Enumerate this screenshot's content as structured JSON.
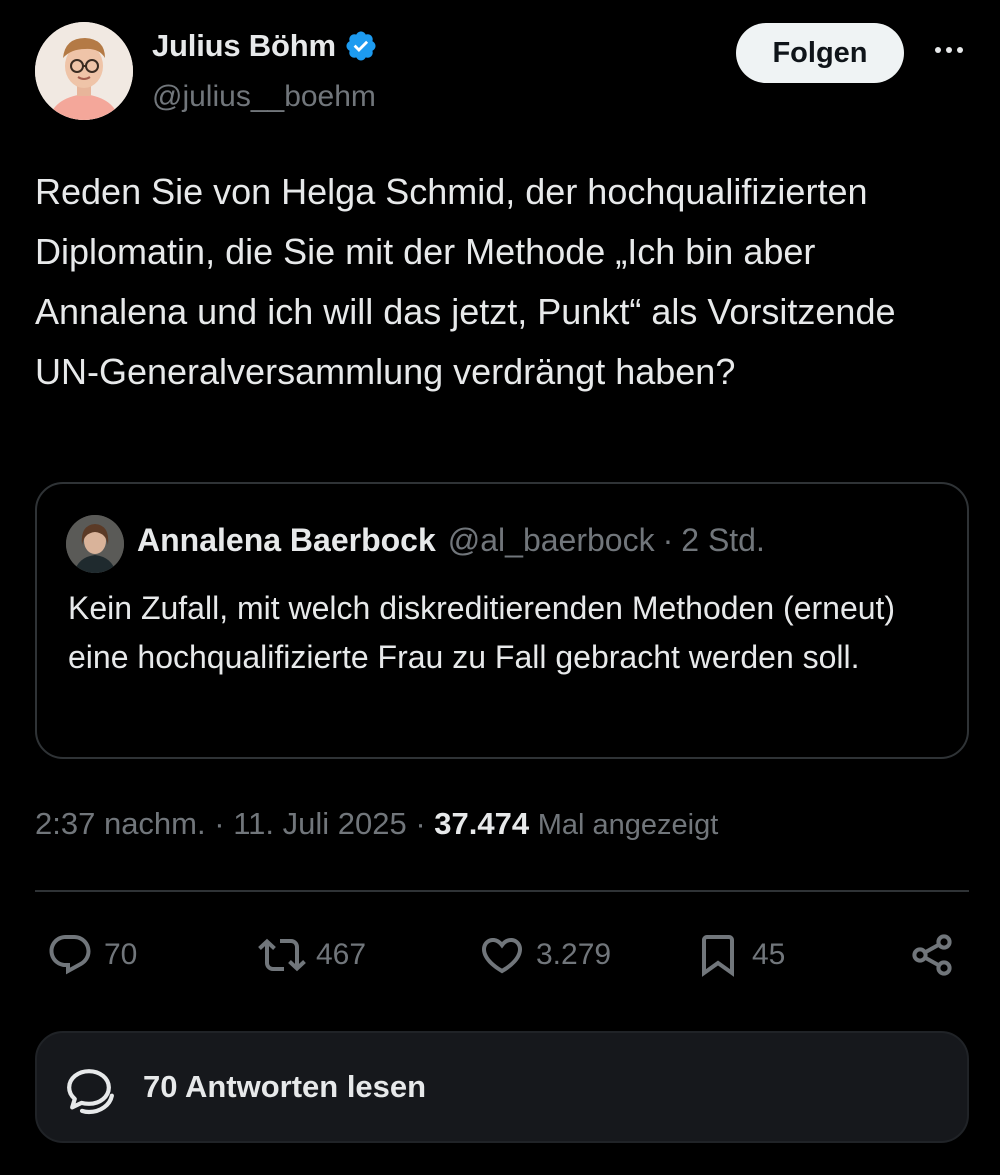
{
  "author": {
    "name": "Julius Böhm",
    "handle": "@julius__boehm",
    "verified": true
  },
  "follow_button": {
    "label": "Folgen"
  },
  "tweet": {
    "text": "Reden Sie von Helga Schmid, der hochqualifizierten Diplomatin, die Sie mit der Methode „Ich bin aber Annalena und ich will das jetzt, Punkt“ als Vorsitzende  UN-Generalversammlung verdrängt haben?",
    "time": "2:37 nachm.",
    "date": "11. Juli 2025",
    "views_count": "37.474",
    "views_label": "Mal angezeigt"
  },
  "quote": {
    "name": "Annalena Baerbock",
    "handle": "@al_baerbock",
    "time": "2 Std.",
    "text": "Kein Zufall, mit welch diskreditierenden Methoden (erneut) eine hochqualifizierte Frau zu Fall gebracht werden soll."
  },
  "actions": {
    "replies": "70",
    "retweets": "467",
    "likes": "3.279",
    "bookmarks": "45"
  },
  "reply_box": {
    "label": "70 Antworten lesen"
  },
  "separator": "·",
  "icons": [
    "verified-badge-icon",
    "more-icon",
    "reply-icon",
    "retweet-icon",
    "like-icon",
    "bookmark-icon",
    "share-icon",
    "read-replies-icon"
  ],
  "colors": {
    "background": "#000000",
    "text": "#e7e9ea",
    "muted": "#71767b",
    "verified": "#1d9bf0",
    "border": "#2f3336"
  }
}
